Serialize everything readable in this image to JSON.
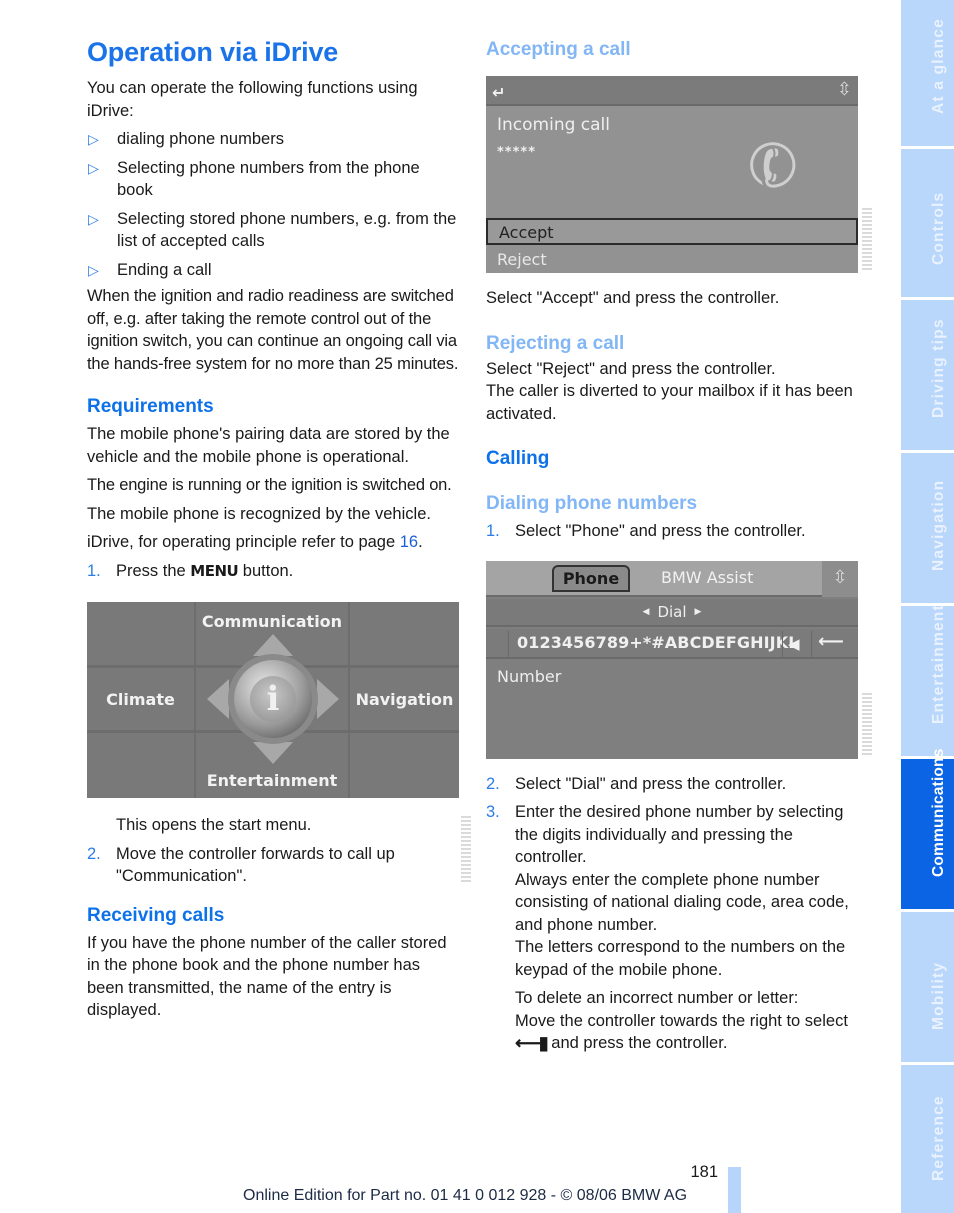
{
  "page": {
    "title": "Operation via iDrive",
    "page_number": "181",
    "footer": "Online Edition for Part no. 01 41 0 012 928 - © 08/06 BMW AG"
  },
  "colors": {
    "heading_blue": "#0d72ea",
    "subheading_light_blue": "#82b6f5",
    "side_tab_inactive": "#b9d6fb",
    "side_tab_active": "#0a64e3"
  },
  "left": {
    "intro": "You can operate the following functions using iDrive:",
    "bullets": [
      "dialing phone numbers",
      "Selecting phone numbers from the phone book",
      "Selecting stored phone numbers, e.g. from the list of accepted calls",
      "Ending a call"
    ],
    "ignition_note": "When the ignition and radio readiness are switched off, e.g. after taking the remote control out of the ignition switch, you can continue an ongoing call via the hands-free system for no more than 25 minutes.",
    "requirements": {
      "heading": "Requirements",
      "p1": "The mobile phone's pairing data are stored by the vehicle and the mobile phone is operational.",
      "p2": "The engine is running or the ignition is switched on.",
      "p3": "The mobile phone is recognized by the vehicle.",
      "p4_prefix": "iDrive, for operating principle refer to page ",
      "p4_link": "16",
      "p4_suffix": "."
    },
    "steps": [
      {
        "num": "1.",
        "prefix": "Press the ",
        "glyph": "MENU",
        "suffix": " button."
      },
      {
        "num": "2.",
        "text": "Move the controller forwards to call up \"Communication\"."
      }
    ],
    "after_image": "This opens the start menu.",
    "start_menu": {
      "top": "Communication",
      "left": "Climate",
      "right": "Navigation",
      "bottom": "Entertainment",
      "center_glyph": "i"
    },
    "receiving": {
      "heading": "Receiving calls",
      "text": "If you have the phone number of the caller stored in the phone book and the phone number has been transmitted, the name of the entry is displayed."
    }
  },
  "right": {
    "accepting": {
      "heading": "Accepting a call",
      "screen": {
        "back_icon": "↵",
        "title": "Incoming call",
        "masked_number": "*****",
        "options": [
          "Accept",
          "Reject"
        ],
        "selected": "Accept"
      },
      "text": "Select \"Accept\" and press the controller."
    },
    "rejecting": {
      "heading": "Rejecting a call",
      "text1": "Select \"Reject\" and press the controller.",
      "text2": "The caller is diverted to your mailbox if it has been activated."
    },
    "calling": {
      "heading": "Calling"
    },
    "dialing": {
      "heading": "Dialing phone numbers",
      "step1": {
        "num": "1.",
        "text": "Select \"Phone\" and press the controller."
      },
      "screen": {
        "tab_active": "Phone",
        "tab_other": "BMW Assist",
        "mode": "Dial",
        "characters": "0123456789+*#ABCDEFGHIJKL",
        "field_label": "Number"
      },
      "step2": {
        "num": "2.",
        "text": "Select \"Dial\" and press the controller."
      },
      "step3": {
        "num": "3.",
        "text": "Enter the desired phone number by selecting the digits individually and pressing the controller.",
        "text_b": "Always enter the complete phone number consisting of national dialing code, area code, and phone number.",
        "text_c": "The letters correspond to the numbers on the keypad of the mobile phone."
      },
      "delete_note_1": "To delete an incorrect number or letter:",
      "delete_note_2_prefix": "Move the controller towards the right to select ",
      "delete_note_2_suffix": " and press the controller."
    }
  },
  "side_tabs": [
    {
      "label": "At a glance",
      "active": false
    },
    {
      "label": "Controls",
      "active": false
    },
    {
      "label": "Driving tips",
      "active": false
    },
    {
      "label": "Navigation",
      "active": false
    },
    {
      "label": "Entertainment",
      "active": false
    },
    {
      "label": "Communications",
      "active": true
    },
    {
      "label": "Mobility",
      "active": false
    },
    {
      "label": "Reference",
      "active": false
    }
  ]
}
